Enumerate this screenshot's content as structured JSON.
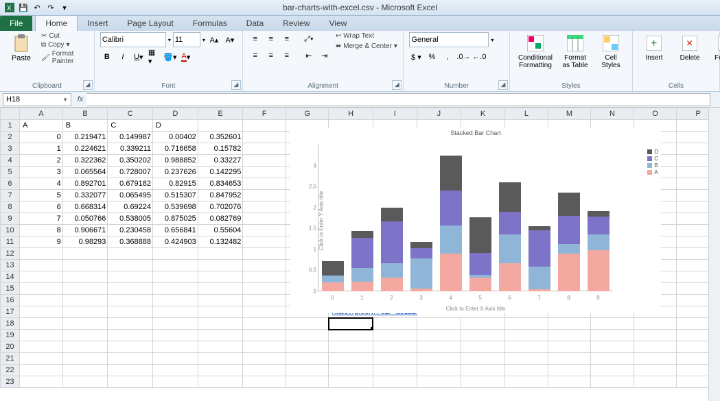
{
  "title": "bar-charts-with-excel.csv - Microsoft Excel",
  "qat": {
    "save": "💾",
    "undo": "↶",
    "redo": "↷",
    "customize": "▾"
  },
  "tabs": {
    "file": "File",
    "home": "Home",
    "insert": "Insert",
    "page_layout": "Page Layout",
    "formulas": "Formulas",
    "data": "Data",
    "review": "Review",
    "view": "View"
  },
  "ribbon": {
    "clipboard": {
      "paste": "Paste",
      "cut": "Cut",
      "copy": "Copy",
      "format_painter": "Format Painter",
      "label": "Clipboard"
    },
    "font": {
      "name": "Calibri",
      "size": "11",
      "label": "Font"
    },
    "alignment": {
      "wrap": "Wrap Text",
      "merge": "Merge & Center",
      "label": "Alignment"
    },
    "number": {
      "format": "General",
      "label": "Number"
    },
    "styles": {
      "cond": "Conditional Formatting",
      "table": "Format as Table",
      "cell": "Cell Styles",
      "label": "Styles"
    },
    "cells": {
      "insert": "Insert",
      "delete": "Delete",
      "format": "Format",
      "label": "Cells"
    }
  },
  "namebox": "H18",
  "columns": [
    "A",
    "B",
    "C",
    "D",
    "E",
    "F",
    "G",
    "H",
    "I",
    "J",
    "K",
    "L",
    "M",
    "N",
    "O",
    "P"
  ],
  "header_row": {
    "A": "A",
    "B": "B",
    "C": "C",
    "D": "D"
  },
  "data_rows": [
    {
      "A": "0",
      "B": "0.219471",
      "C": "0.149987",
      "D": "0.00402",
      "E": "0.352601"
    },
    {
      "A": "1",
      "B": "0.224621",
      "C": "0.339211",
      "D": "0.716658",
      "E": "0.15782"
    },
    {
      "A": "2",
      "B": "0.322362",
      "C": "0.350202",
      "D": "0.988852",
      "E": "0.33227"
    },
    {
      "A": "3",
      "B": "0.065564",
      "C": "0.728007",
      "D": "0.237626",
      "E": "0.142295"
    },
    {
      "A": "4",
      "B": "0.892701",
      "C": "0.679182",
      "D": "0.82915",
      "E": "0.834653"
    },
    {
      "A": "5",
      "B": "0.332077",
      "C": "0.065495",
      "D": "0.515307",
      "E": "0.847952"
    },
    {
      "A": "6",
      "B": "0.668314",
      "C": "0.69224",
      "D": "0.539698",
      "E": "0.702076"
    },
    {
      "A": "7",
      "B": "0.050766",
      "C": "0.538005",
      "D": "0.875025",
      "E": "0.082769"
    },
    {
      "A": "8",
      "B": "0.906671",
      "C": "0.230458",
      "D": "0.656841",
      "E": "0.55604"
    },
    {
      "A": "9",
      "B": "0.98293",
      "C": "0.368888",
      "D": "0.424903",
      "E": "0.132482"
    }
  ],
  "link_cell": "https://plot.ly/762/~tarzzz/",
  "selected_cell": "H18",
  "chart_data": {
    "type": "bar",
    "stacked": true,
    "title": "Stacked Bar Chart",
    "xlabel": "Click to Enter X Axis title",
    "ylabel": "Click to Enter Y Axis title",
    "categories": [
      "0",
      "1",
      "2",
      "3",
      "4",
      "5",
      "6",
      "7",
      "8",
      "9"
    ],
    "series": [
      {
        "name": "A",
        "color": "#f4a9a0",
        "values": [
          0.219471,
          0.224621,
          0.322362,
          0.065564,
          0.892701,
          0.332077,
          0.668314,
          0.050766,
          0.906671,
          0.98293
        ]
      },
      {
        "name": "B",
        "color": "#8fb6d6",
        "values": [
          0.149987,
          0.339211,
          0.350202,
          0.728007,
          0.679182,
          0.065495,
          0.69224,
          0.538005,
          0.230458,
          0.368888
        ]
      },
      {
        "name": "C",
        "color": "#7d74c9",
        "values": [
          0.00402,
          0.716658,
          0.988852,
          0.237626,
          0.82915,
          0.515307,
          0.539698,
          0.875025,
          0.656841,
          0.424903
        ]
      },
      {
        "name": "D",
        "color": "#5a5a5a",
        "values": [
          0.352601,
          0.15782,
          0.33227,
          0.142295,
          0.834653,
          0.847952,
          0.702076,
          0.082769,
          0.55604,
          0.132482
        ]
      }
    ],
    "ylim": [
      0,
      3.5
    ],
    "yticks": [
      0,
      0.5,
      1,
      1.5,
      2,
      2.5,
      3
    ],
    "legend_order": [
      "D",
      "C",
      "B",
      "A"
    ]
  }
}
